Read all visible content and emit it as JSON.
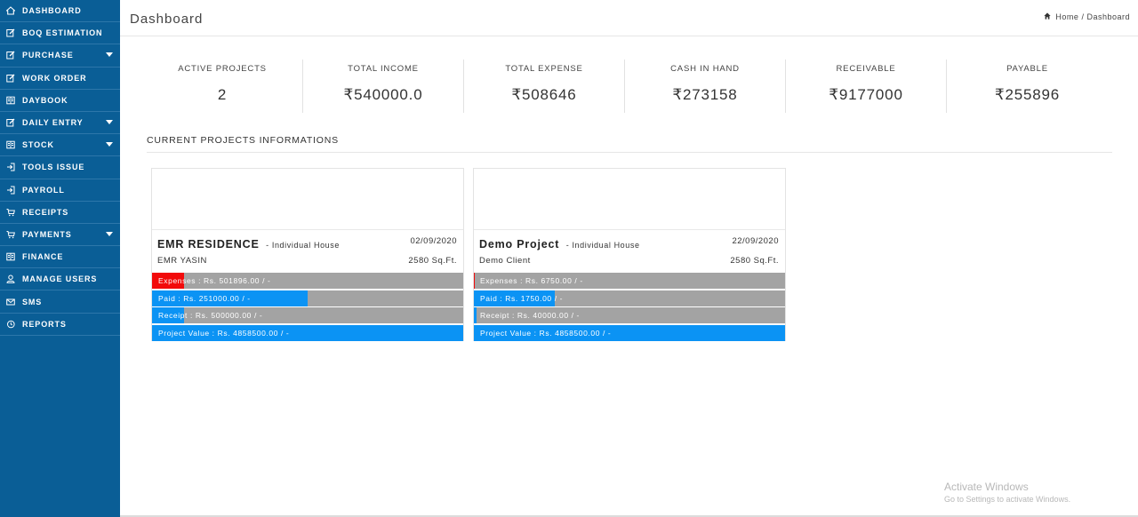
{
  "sidebar": {
    "items": [
      {
        "label": "DASHBOARD",
        "icon": "home-icon"
      },
      {
        "label": "BOQ ESTIMATION",
        "icon": "edit-icon"
      },
      {
        "label": "PURCHASE",
        "icon": "edit-icon",
        "has_submenu": true
      },
      {
        "label": "WORK ORDER",
        "icon": "edit-icon"
      },
      {
        "label": "DAYBOOK",
        "icon": "book-icon"
      },
      {
        "label": "DAILY ENTRY",
        "icon": "edit-icon",
        "has_submenu": true
      },
      {
        "label": "STOCK",
        "icon": "book-icon",
        "has_submenu": true
      },
      {
        "label": "TOOLS ISSUE",
        "icon": "sign-in-icon"
      },
      {
        "label": "PAYROLL",
        "icon": "sign-in-icon"
      },
      {
        "label": "RECEIPTS",
        "icon": "cart-icon"
      },
      {
        "label": "PAYMENTS",
        "icon": "cart-icon",
        "has_submenu": true
      },
      {
        "label": "FINANCE",
        "icon": "book-icon"
      },
      {
        "label": "MANAGE USERS",
        "icon": "user-icon"
      },
      {
        "label": "SMS",
        "icon": "envelope-icon"
      },
      {
        "label": "REPORTS",
        "icon": "history-icon"
      }
    ]
  },
  "header": {
    "title": "Dashboard",
    "breadcrumb": {
      "home": "Home",
      "separator": "/",
      "current": "Dashboard"
    }
  },
  "stats": [
    {
      "label": "ACTIVE PROJECTS",
      "value": "2"
    },
    {
      "label": "TOTAL INCOME",
      "value": "₹540000.0"
    },
    {
      "label": "TOTAL EXPENSE",
      "value": "₹508646"
    },
    {
      "label": "CASH IN HAND",
      "value": "₹273158"
    },
    {
      "label": "RECEIVABLE",
      "value": "₹9177000"
    },
    {
      "label": "PAYABLE",
      "value": "₹255896"
    }
  ],
  "section_title": "CURRENT PROJECTS INFORMATIONS",
  "projects": [
    {
      "name": "EMR RESIDENCE",
      "type": "- Individual House",
      "date": "02/09/2020",
      "client": "EMR YASIN",
      "area": "2580 Sq.Ft.",
      "bars": [
        {
          "label": "Expenses : Rs. 501896.00 / -",
          "fill_fraction": 0.103,
          "fill_color": "#f20a0a"
        },
        {
          "label": "Paid : Rs. 251000.00 / -",
          "fill_fraction": 0.5,
          "fill_color": "#0b93f4"
        },
        {
          "label": "Receipt : Rs. 500000.00 / -",
          "fill_fraction": 0.103,
          "fill_color": "#0b93f4"
        },
        {
          "label": "Project Value : Rs. 4858500.00 / -",
          "fill_fraction": 1.0,
          "fill_color": "#0b93f4"
        }
      ]
    },
    {
      "name": "Demo Project",
      "type": "- Individual House",
      "date": "22/09/2020",
      "client": "Demo Client",
      "area": "2580 Sq.Ft.",
      "bars": [
        {
          "label": "Expenses : Rs. 6750.00 / -",
          "fill_fraction": 0.004,
          "fill_color": "#f20a0a"
        },
        {
          "label": "Paid : Rs. 1750.00 / -",
          "fill_fraction": 0.26,
          "fill_color": "#0b93f4"
        },
        {
          "label": "Receipt : Rs. 40000.00 / -",
          "fill_fraction": 0.008,
          "fill_color": "#0b93f4"
        },
        {
          "label": "Project Value : Rs. 4858500.00 / -",
          "fill_fraction": 1.0,
          "fill_color": "#0b93f4"
        }
      ]
    }
  ],
  "watermark": {
    "line1": "Activate Windows",
    "line2": "Go to Settings to activate Windows."
  },
  "colors": {
    "sidebar": "#0a5e96",
    "expense": "#f20a0a",
    "accent": "#0b93f4",
    "bar_track": "#a3a3a3"
  }
}
